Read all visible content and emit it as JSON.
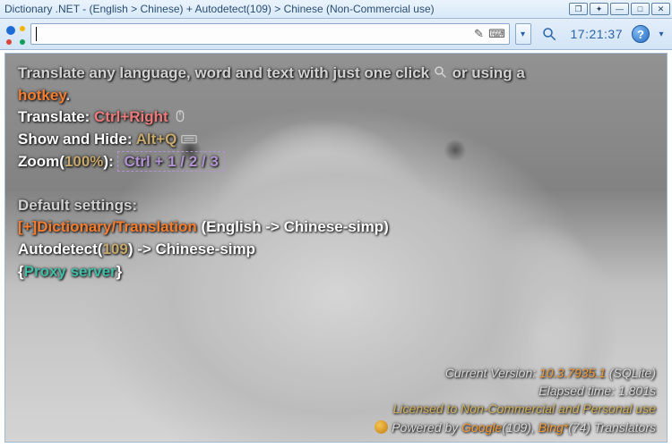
{
  "window": {
    "title": "Dictionary .NET - (English > Chinese) + Autodetect(109) > Chinese (Non-Commercial use)"
  },
  "toolbar": {
    "search_value": "",
    "clock": "17:21:37"
  },
  "intro": {
    "line1_a": "Translate any language, word and text with just one click",
    "line1_b": " or using a ",
    "hotkey": "hotkey",
    "period": ".",
    "translate_label": "Translate: ",
    "translate_keys": "Ctrl+Right",
    "showhide_label": "Show and Hide: ",
    "showhide_keys": "Alt+Q",
    "zoom_label_a": "Zoom(",
    "zoom_pct": "100%",
    "zoom_label_b": "): ",
    "zoom_keys": "Ctrl + 1 / 2 / 3",
    "defaults_heading": "Default settings:",
    "dict_toggle": "[+]Dictionary/Translation",
    "dict_lang": " (English -> Chinese-simp)",
    "autodetect_a": "Autodetect(",
    "autodetect_n": "109",
    "autodetect_b": ") -> Chinese-simp",
    "brace_open": "{",
    "proxy": "Proxy server",
    "brace_close": "}"
  },
  "footer": {
    "ver_label": "Current Version: ",
    "ver_value": "10.3.7935.1",
    "ver_suffix": " (SQLite)",
    "elapsed": "Elapsed time: 1.801s",
    "license": "Licensed to Non-Commercial and Personal use",
    "powered_a": "Powered by ",
    "google": "Google",
    "google_n": "(109), ",
    "bing": "Bing*",
    "bing_n": "(74) ",
    "translators": "Translators"
  }
}
